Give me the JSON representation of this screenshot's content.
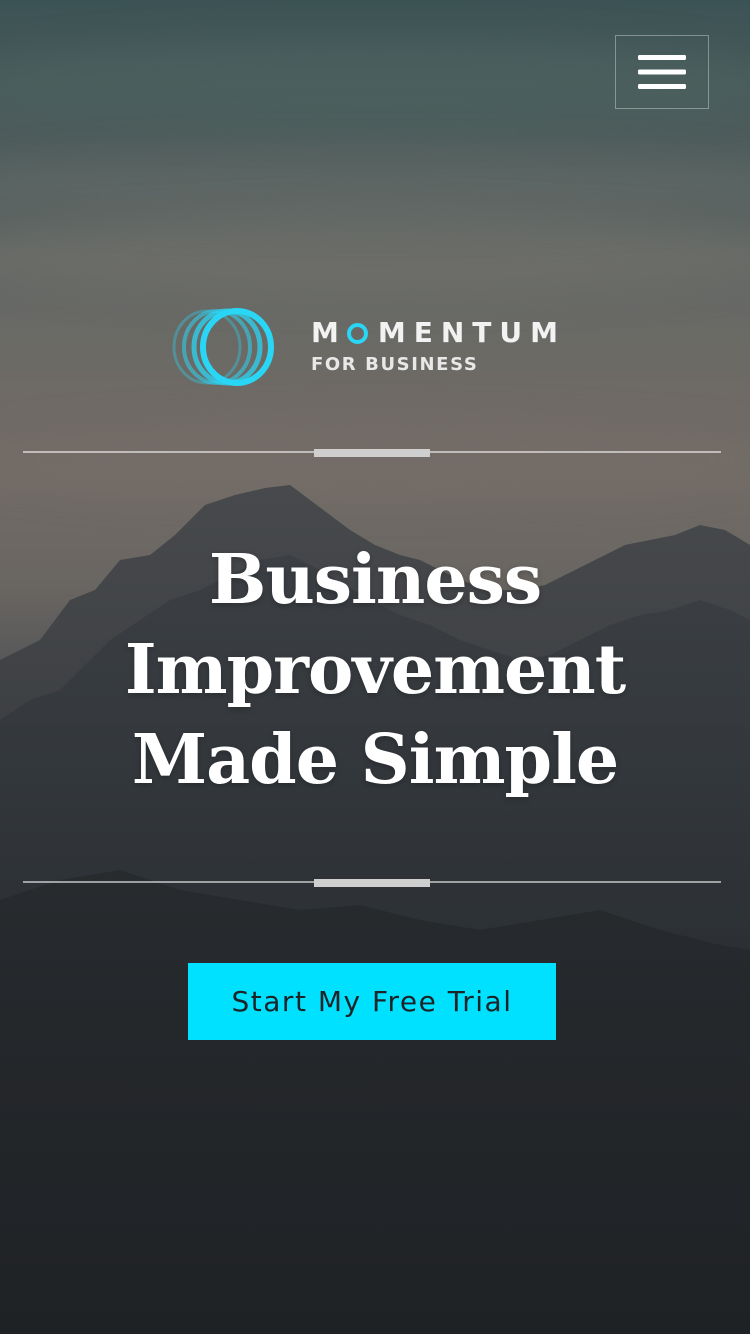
{
  "header": {
    "menu_icon": "hamburger-menu-icon"
  },
  "brand": {
    "logo_icon": "momentum-rings-logo-icon",
    "name_first": "M",
    "name_rest": "MENTUM",
    "tagline": "FOR BUSINESS",
    "accent_color": "#29d6f5"
  },
  "hero": {
    "headline_line1": "Business",
    "headline_line2": "Improvement",
    "headline_line3": "Made Simple",
    "cta_label": "Start My Free Trial",
    "cta_color": "#00e0ff"
  }
}
